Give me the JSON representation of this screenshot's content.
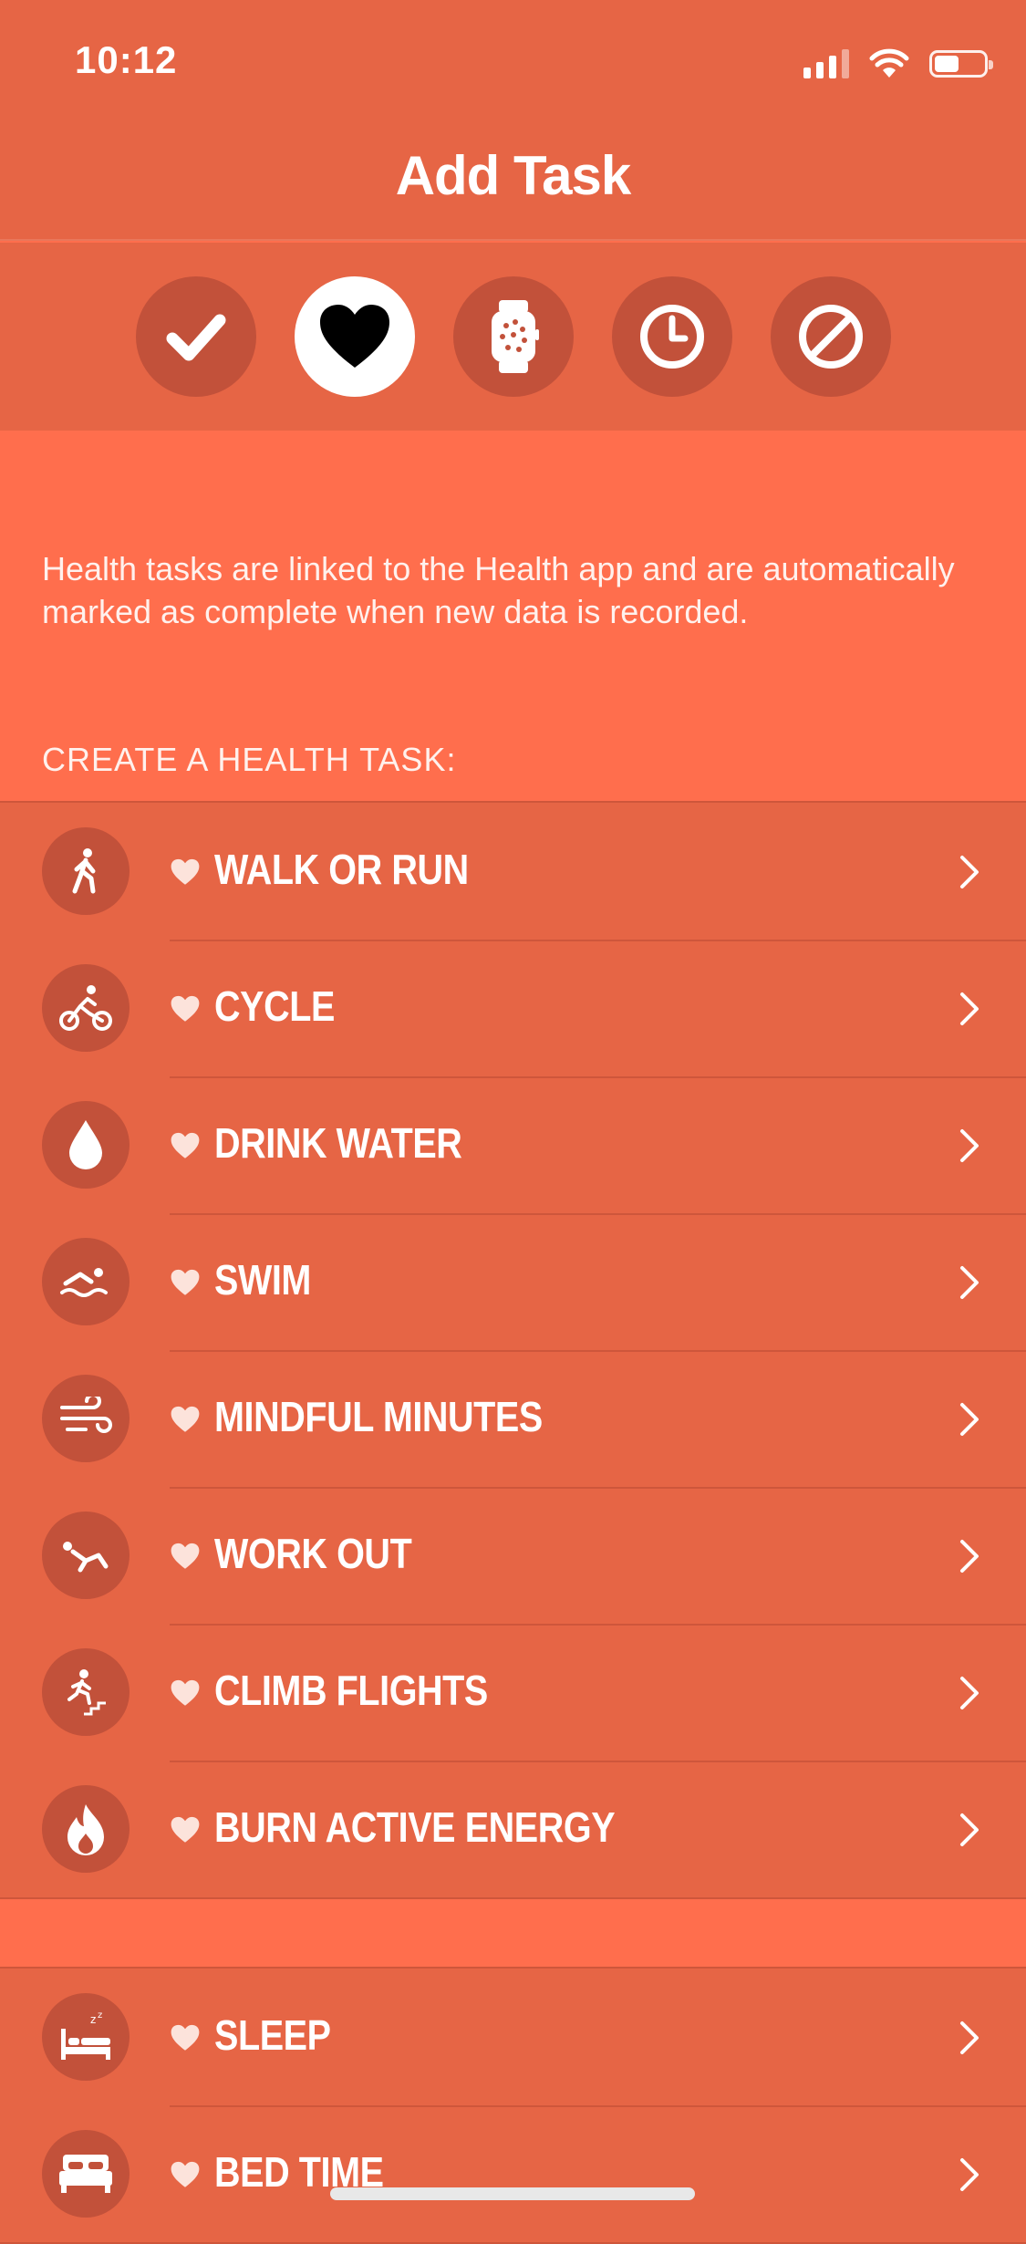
{
  "status": {
    "time": "10:12"
  },
  "nav": {
    "title": "Add Task"
  },
  "categories": [
    {
      "icon": "checkmark-icon",
      "active": false
    },
    {
      "icon": "heart-icon",
      "active": true
    },
    {
      "icon": "watch-icon",
      "active": false
    },
    {
      "icon": "clock-icon",
      "active": false
    },
    {
      "icon": "prohibited-icon",
      "active": false
    }
  ],
  "info_text": "Health tasks are linked to the Health app and are automatically marked as complete when new data is recorded.",
  "section_header": "CREATE A HEALTH TASK:",
  "health_tasks": [
    {
      "label": "WALK OR RUN",
      "icon": "walking-icon"
    },
    {
      "label": "CYCLE",
      "icon": "cycling-icon"
    },
    {
      "label": "DRINK WATER",
      "icon": "water-drop-icon"
    },
    {
      "label": "SWIM",
      "icon": "swimming-icon"
    },
    {
      "label": "MINDFUL MINUTES",
      "icon": "wind-icon"
    },
    {
      "label": "WORK OUT",
      "icon": "workout-icon"
    },
    {
      "label": "CLIMB FLIGHTS",
      "icon": "stairs-icon"
    },
    {
      "label": "BURN ACTIVE ENERGY",
      "icon": "flame-icon"
    }
  ],
  "sleep_tasks": [
    {
      "label": "SLEEP",
      "icon": "sleep-bed-icon"
    },
    {
      "label": "BED TIME",
      "icon": "bed-icon"
    }
  ],
  "colors": {
    "background": "#FF6E4D",
    "bar": "#E66545",
    "circle": "#C2513A"
  }
}
